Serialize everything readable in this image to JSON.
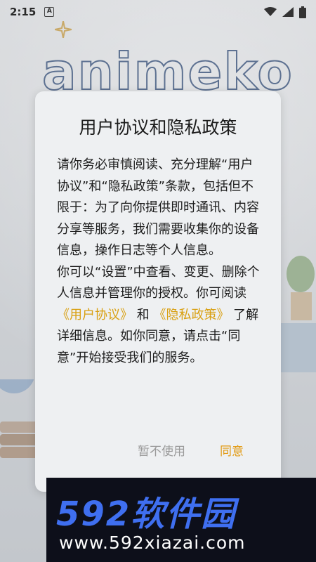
{
  "status_bar": {
    "time": "2:15",
    "notification_badge": "A",
    "icons": [
      "wifi-icon",
      "signal-icon",
      "battery-icon"
    ]
  },
  "splash": {
    "logo_text": "animeko"
  },
  "dialog": {
    "title": "用户协议和隐私政策",
    "body_intro": "请你务必审慎阅读、充分理解“用户协议”和“隐私政策”条款，包括但不限于：为了向你提供即时通讯、内容分享等服务，我们需要收集你的设备信息，操作日志等个人信息。",
    "body_manage": "你可以“设置”中查看、变更、删除个人信息并管理你的授权。你可阅读",
    "link_user_agreement": "《用户协议》",
    "and_text": " 和 ",
    "link_privacy_policy": "《隐私政策》",
    "body_tail": " 了解详细信息。如你同意，请点击“同意”开始接受我们的服务。",
    "decline_label": "暂不使用",
    "agree_label": "同意"
  },
  "watermark": {
    "brand": "592软件园",
    "url": "www.592xiazai.com"
  },
  "colors": {
    "accent": "#e29a12",
    "link": "#d9a012",
    "dialog_bg": "#eef0f2",
    "watermark_blue": "#3f6ff0"
  }
}
